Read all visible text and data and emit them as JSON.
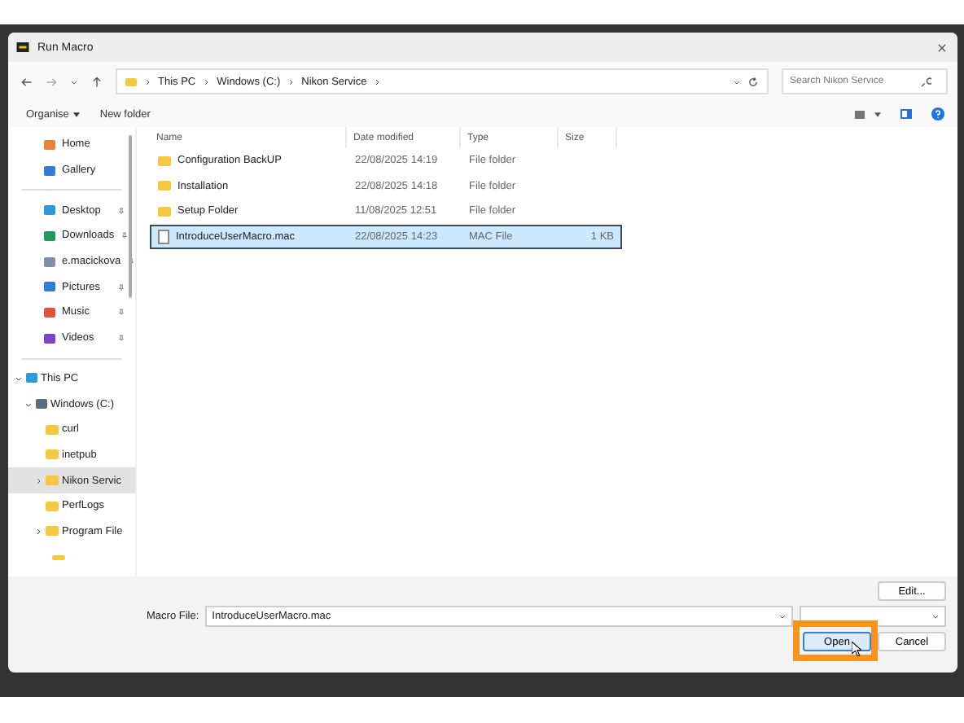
{
  "window": {
    "title": "Run Macro"
  },
  "breadcrumb": [
    "This PC",
    "Windows (C:)",
    "Nikon Service"
  ],
  "search": {
    "placeholder": "Search Nikon Service"
  },
  "toolbar": {
    "organise": "Organise",
    "new_folder": "New folder"
  },
  "sidebar": {
    "quick": [
      "Home",
      "Gallery"
    ],
    "pinned": [
      "Desktop",
      "Downloads",
      "e.macickova",
      "Pictures",
      "Music",
      "Videos"
    ],
    "tree": [
      {
        "label": "This PC",
        "expanded": true,
        "selected": false,
        "children": [
          {
            "label": "Windows (C:)",
            "expanded": true,
            "selected": false,
            "children": [
              {
                "label": "curl",
                "selected": false
              },
              {
                "label": "inetpub",
                "selected": false
              },
              {
                "label": "Nikon Servic",
                "expanded": false,
                "selected": true
              },
              {
                "label": "PerfLogs",
                "selected": false
              },
              {
                "label": "Program File",
                "expanded": false,
                "selected": false
              }
            ]
          }
        ]
      }
    ]
  },
  "table": {
    "columns": [
      "Name",
      "Date modified",
      "Type",
      "Size"
    ],
    "rows": [
      {
        "name": "Configuration BackUP",
        "date": "22/08/2025 14:19",
        "type": "File folder",
        "kind": "folder",
        "selected": false
      },
      {
        "name": "Installation",
        "date": "22/08/2025 14:18",
        "type": "File folder",
        "kind": "folder",
        "selected": false
      },
      {
        "name": "Setup Folder",
        "date": "11/08/2025 12:51",
        "type": "File folder",
        "kind": "folder",
        "selected": false
      },
      {
        "name": "IntroduceUserMacro.mac",
        "date": "22/08/2025 14:23",
        "type": "MAC File",
        "size": "1 KB",
        "kind": "file",
        "selected": true
      }
    ]
  },
  "footer": {
    "edit": "Edit...",
    "file_label": "Macro File:",
    "file_value": "IntroduceUserMacro.mac",
    "open": "Open",
    "cancel": "Cancel"
  }
}
